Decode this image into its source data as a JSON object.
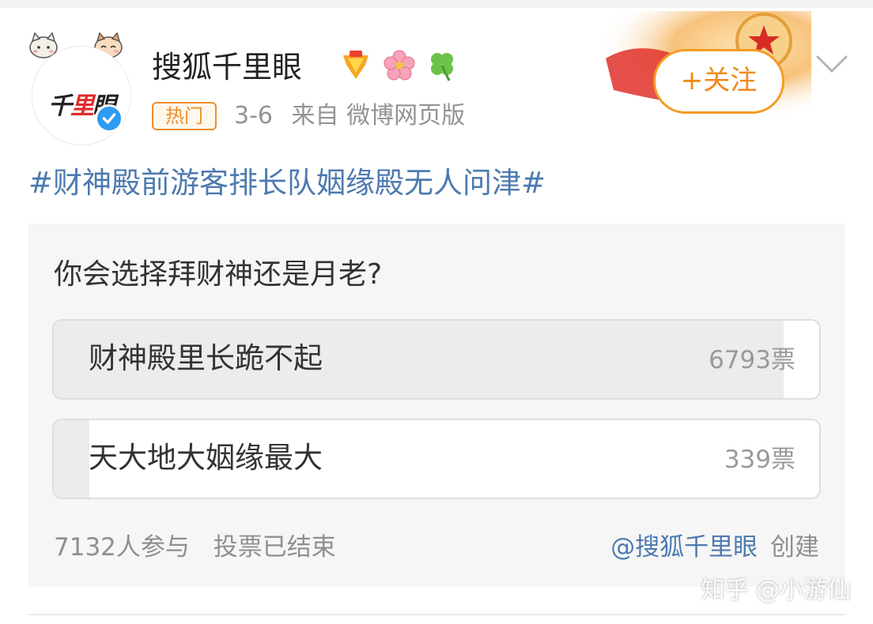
{
  "post": {
    "author": "搜狐千里眼",
    "avatar_text": "千里眼",
    "hot_tag": "热门",
    "date": "3-6",
    "source": "来自 微博网页版",
    "follow_label": "+关注",
    "topic": "#财神殿前游客排长队姻缘殿无人问津#"
  },
  "poll": {
    "question": "你会选择拜财神还是月老?",
    "options": [
      {
        "label": "财神殿里长跪不起",
        "count": "6793票",
        "share": 0.953
      },
      {
        "label": "天大地大姻缘最大",
        "count": "339票",
        "share": 0.047
      }
    ],
    "participants": "7132人参与",
    "status": "投票已结束",
    "creator": "@搜狐千里眼",
    "created_label": "创建"
  },
  "watermark": "知乎 @小游仙",
  "colors": {
    "link": "#4d7ab0",
    "accent_orange": "#f39c24",
    "verified_blue": "#2e9bf0"
  },
  "icons": [
    "cat-sticker-icon",
    "verified-icon",
    "medal-icon",
    "flower-icon",
    "clover-icon",
    "chevron-down-icon"
  ]
}
